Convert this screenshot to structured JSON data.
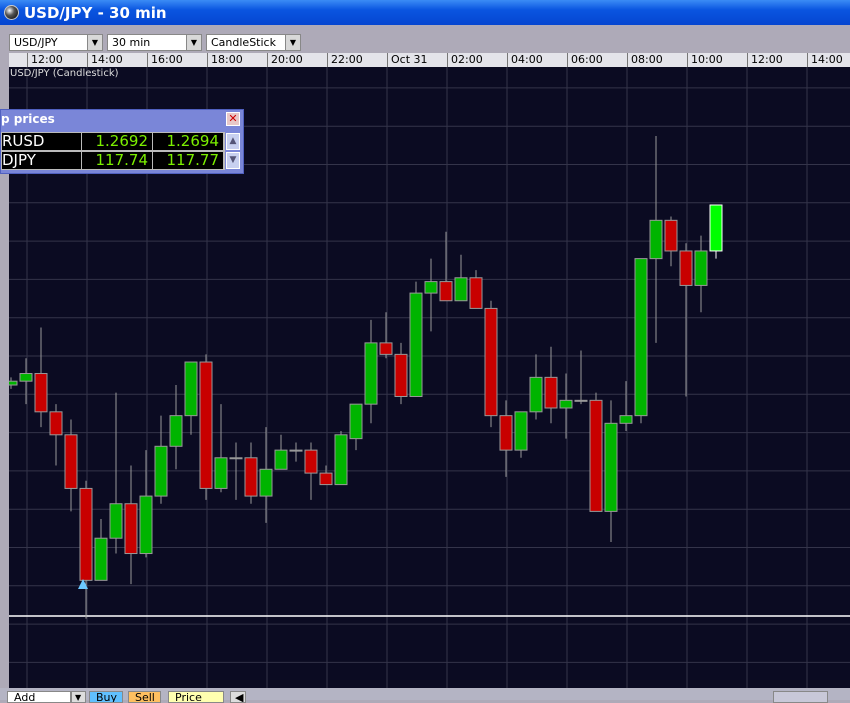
{
  "window": {
    "title": "USD/JPY - 30 min"
  },
  "toolbar": {
    "symbol": "USD/JPY",
    "interval": "30 min",
    "chart_type": "CandleStick"
  },
  "chart_label": "USD/JPY (Candlestick)",
  "time_axis": [
    "12:00",
    "14:00",
    "16:00",
    "18:00",
    "20:00",
    "22:00",
    "Oct 31",
    "02:00",
    "04:00",
    "06:00",
    "08:00",
    "10:00",
    "12:00",
    "14:00"
  ],
  "price_window": {
    "title": "p prices",
    "rows": [
      {
        "symbol": "RUSD",
        "bid": "1.2692",
        "ask": "1.2694"
      },
      {
        "symbol": "DJPY",
        "bid": "117.74",
        "ask": "117.77"
      }
    ]
  },
  "bottom_bar": {
    "add_study": "Add Study",
    "buy": "Buy",
    "sell": "Sell",
    "price_box": "Price Box"
  },
  "colors": {
    "up": "#00b400",
    "down": "#c80000",
    "live": "#00ff00",
    "background": "#0b0b22"
  },
  "chart_data": {
    "type": "candlestick",
    "interval": "30 min",
    "candles": [
      [
        117.27,
        117.29,
        117.26,
        117.28
      ],
      [
        117.28,
        117.34,
        117.22,
        117.3
      ],
      [
        117.3,
        117.42,
        117.16,
        117.2
      ],
      [
        117.2,
        117.22,
        117.06,
        117.14
      ],
      [
        117.14,
        117.18,
        116.94,
        117.0
      ],
      [
        117.0,
        117.02,
        116.66,
        116.76
      ],
      [
        116.76,
        116.92,
        116.76,
        116.87
      ],
      [
        116.87,
        117.25,
        116.83,
        116.96
      ],
      [
        116.96,
        117.06,
        116.75,
        116.83
      ],
      [
        116.83,
        117.1,
        116.82,
        116.98
      ],
      [
        116.98,
        117.19,
        116.96,
        117.11
      ],
      [
        117.11,
        117.27,
        117.05,
        117.19
      ],
      [
        117.19,
        117.33,
        117.14,
        117.33
      ],
      [
        117.33,
        117.35,
        116.97,
        117.0
      ],
      [
        117.0,
        117.22,
        116.99,
        117.08
      ],
      [
        117.08,
        117.12,
        116.97,
        117.08
      ],
      [
        117.08,
        117.12,
        116.96,
        116.98
      ],
      [
        116.98,
        117.16,
        116.91,
        117.05
      ],
      [
        117.05,
        117.14,
        117.05,
        117.1
      ],
      [
        117.1,
        117.12,
        117.07,
        117.1
      ],
      [
        117.1,
        117.12,
        116.97,
        117.04
      ],
      [
        117.04,
        117.06,
        117.01,
        117.01
      ],
      [
        117.01,
        117.15,
        117.01,
        117.14
      ],
      [
        117.13,
        117.22,
        117.1,
        117.22
      ],
      [
        117.22,
        117.44,
        117.17,
        117.38
      ],
      [
        117.38,
        117.46,
        117.34,
        117.35
      ],
      [
        117.35,
        117.38,
        117.22,
        117.24
      ],
      [
        117.24,
        117.54,
        117.24,
        117.51
      ],
      [
        117.51,
        117.6,
        117.41,
        117.54
      ],
      [
        117.54,
        117.67,
        117.49,
        117.49
      ],
      [
        117.49,
        117.61,
        117.49,
        117.55
      ],
      [
        117.55,
        117.57,
        117.47,
        117.47
      ],
      [
        117.47,
        117.49,
        117.16,
        117.19
      ],
      [
        117.19,
        117.23,
        117.03,
        117.1
      ],
      [
        117.1,
        117.2,
        117.08,
        117.2
      ],
      [
        117.2,
        117.35,
        117.18,
        117.29
      ],
      [
        117.29,
        117.37,
        117.17,
        117.21
      ],
      [
        117.21,
        117.3,
        117.13,
        117.23
      ],
      [
        117.23,
        117.36,
        117.22,
        117.23
      ],
      [
        117.23,
        117.25,
        116.94,
        116.94
      ],
      [
        116.94,
        117.23,
        116.86,
        117.17
      ],
      [
        117.17,
        117.28,
        117.15,
        117.19
      ],
      [
        117.19,
        117.6,
        117.17,
        117.6
      ],
      [
        117.6,
        117.92,
        117.38,
        117.7
      ],
      [
        117.7,
        117.71,
        117.58,
        117.62
      ],
      [
        117.62,
        117.64,
        117.24,
        117.53
      ],
      [
        117.53,
        117.66,
        117.46,
        117.62
      ],
      [
        117.62,
        117.74,
        117.6,
        117.74
      ]
    ],
    "candle_fields": [
      "open",
      "high",
      "low",
      "close"
    ],
    "grid": true
  }
}
